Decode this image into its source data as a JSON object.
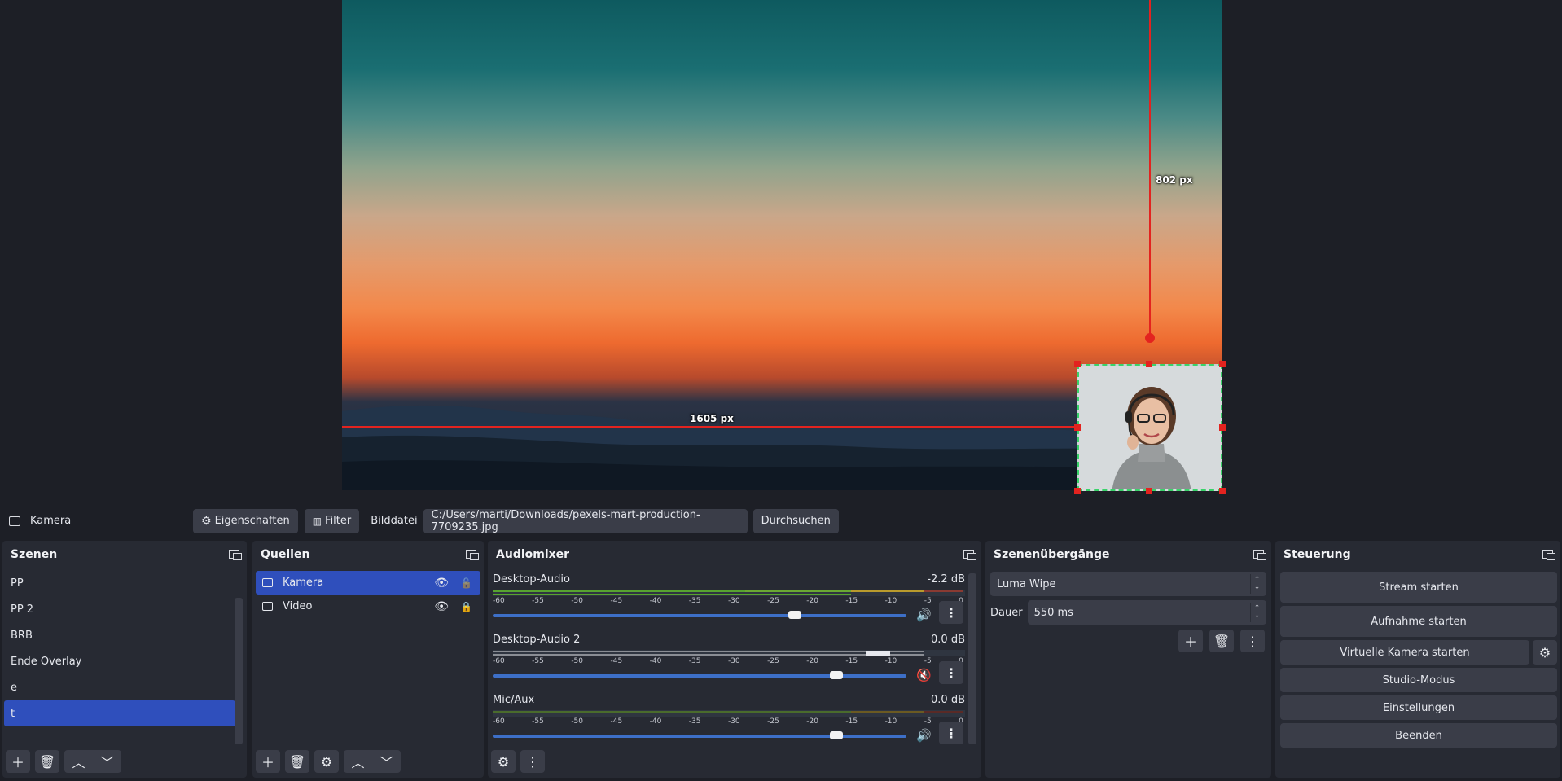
{
  "preview": {
    "measure_width": "1605 px",
    "measure_height": "802 px"
  },
  "propbar": {
    "source_name": "Kamera",
    "properties_label": "Eigenschaften",
    "filter_label": "Filter",
    "file_label": "Bilddatei",
    "file_path": "C:/Users/marti/Downloads/pexels-mart-production-7709235.jpg",
    "browse_label": "Durchsuchen"
  },
  "scenes": {
    "title": "Szenen",
    "items": [
      "PP",
      "PP 2",
      "BRB",
      "Ende Overlay",
      "e",
      "t"
    ],
    "selected_index": 5
  },
  "sources": {
    "title": "Quellen",
    "items": [
      {
        "label": "Kamera",
        "selected": true,
        "visible": true,
        "locked": false
      },
      {
        "label": "Video",
        "selected": false,
        "visible": true,
        "locked": true
      }
    ]
  },
  "audio": {
    "title": "Audiomixer",
    "ticks": [
      "-60",
      "-55",
      "-50",
      "-45",
      "-40",
      "-35",
      "-30",
      "-25",
      "-20",
      "-15",
      "-10",
      "-5",
      "0"
    ],
    "channels": [
      {
        "name": "Desktop-Audio",
        "db": "-2.2 dB",
        "fader_level": 0.73,
        "muted": false
      },
      {
        "name": "Desktop-Audio 2",
        "db": "0.0 dB",
        "fader_level": 0.83,
        "muted": true
      },
      {
        "name": "Mic/Aux",
        "db": "0.0 dB",
        "fader_level": 0.83,
        "muted": false
      }
    ]
  },
  "transitions": {
    "title": "Szenenübergänge",
    "selected": "Luma Wipe",
    "duration_label": "Dauer",
    "duration_value": "550 ms"
  },
  "controls": {
    "title": "Steuerung",
    "stream": "Stream starten",
    "record": "Aufnahme starten",
    "virtual_cam": "Virtuelle Kamera starten",
    "studio": "Studio-Modus",
    "settings": "Einstellungen",
    "exit": "Beenden"
  },
  "colors": {
    "accent": "#2f4fbc",
    "guide": "#e3231f",
    "selection_border": "#39d36a",
    "muted": "#d9363e"
  }
}
